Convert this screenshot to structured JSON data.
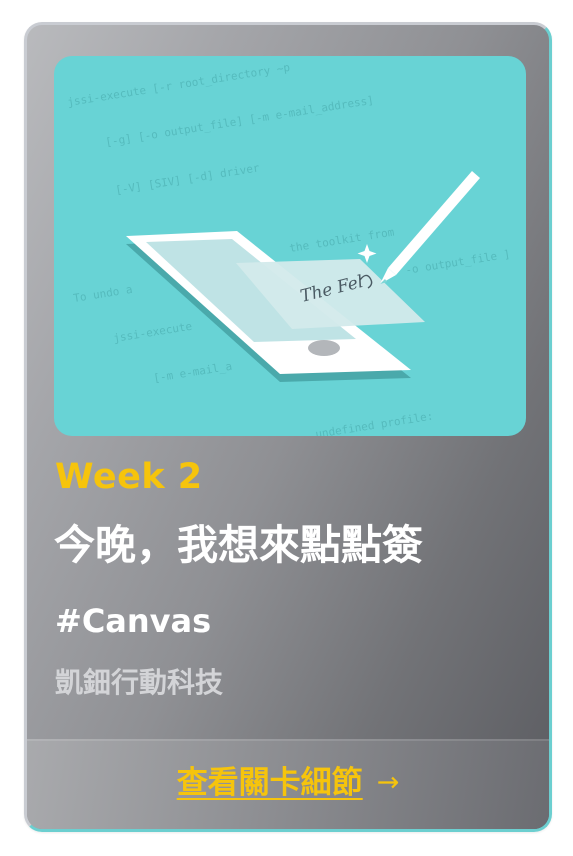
{
  "card": {
    "week_label": "Week 2",
    "title": "今晚，我想來點點簽",
    "tag": "#Canvas",
    "company": "凱鈿行動科技",
    "detail_link_label": "查看關卡細節",
    "detail_link_arrow": "→",
    "colors": {
      "accent_yellow": "#f6c40c",
      "hero_teal": "#68d3d5",
      "title_white": "#ffffff",
      "company_gray": "#d3d4d7"
    }
  },
  "illustration": {
    "icon": "tablet-signature-pen-icon",
    "signature_text": "The Fel",
    "background_code_lines": [
      "jssi-execute [-r root_directory ~p",
      "[-g] [-o output_file] [-m e-mail_address]",
      "[-V] [SIV] [-d] driver",
      "the toolkit from",
      "To undo a",
      "-o output_file ]",
      "jssi-execute",
      "[-m e-mail_a",
      "undefined profile:"
    ]
  }
}
